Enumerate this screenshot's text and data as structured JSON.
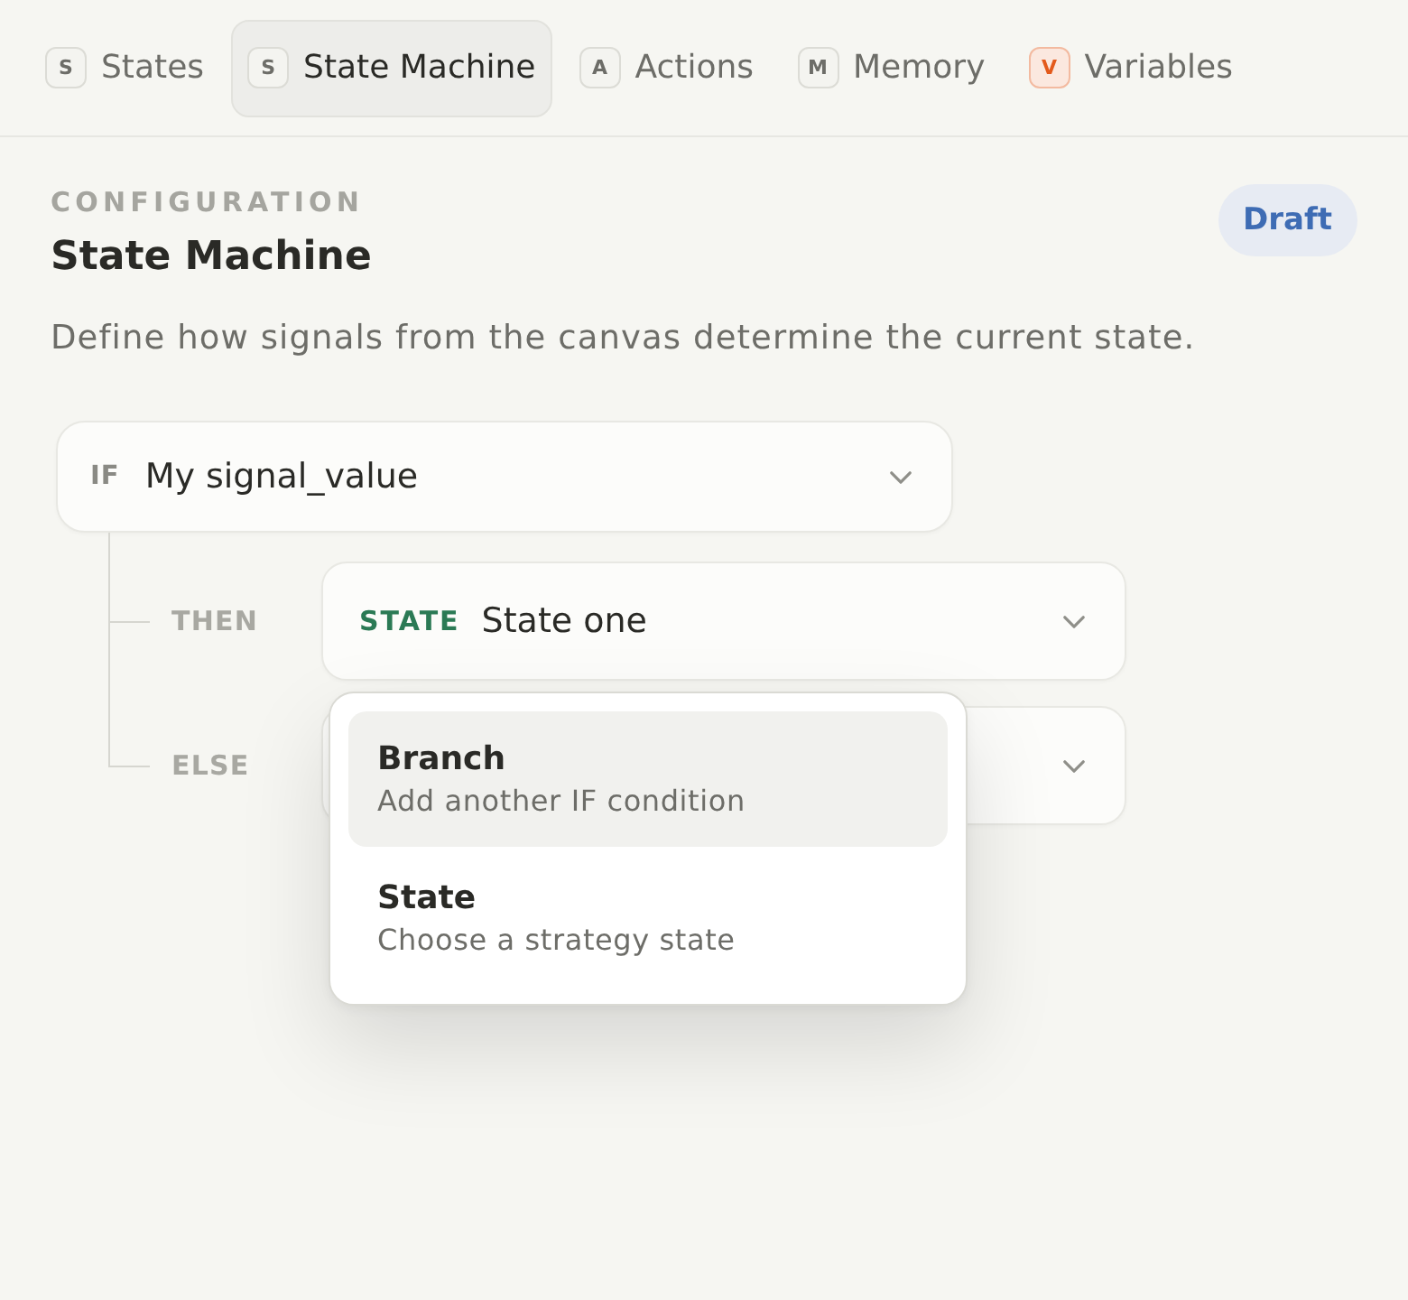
{
  "tabs": [
    {
      "badge": "S",
      "label": "States",
      "selected": false
    },
    {
      "badge": "S",
      "label": "State Machine",
      "selected": true
    },
    {
      "badge": "A",
      "label": "Actions",
      "selected": false
    },
    {
      "badge": "M",
      "label": "Memory",
      "selected": false
    },
    {
      "badge": "V",
      "label": "Variables",
      "selected": false,
      "color": "#e35a1c"
    }
  ],
  "header": {
    "eyebrow": "CONFIGURATION",
    "title": "State Machine",
    "status": "Draft",
    "description": "Define how signals from the canvas determine the current state."
  },
  "rule": {
    "condition": {
      "keyword": "IF",
      "value": "My signal_value"
    },
    "branches": [
      {
        "label": "THEN",
        "target": {
          "tag": "STATE",
          "value": "State one"
        }
      },
      {
        "label": "ELSE",
        "menu": {
          "items": [
            {
              "title": "Branch",
              "subtitle": "Add another IF condition",
              "selected": true
            },
            {
              "title": "State",
              "subtitle": "Choose a strategy state",
              "selected": false
            }
          ]
        }
      }
    ]
  }
}
